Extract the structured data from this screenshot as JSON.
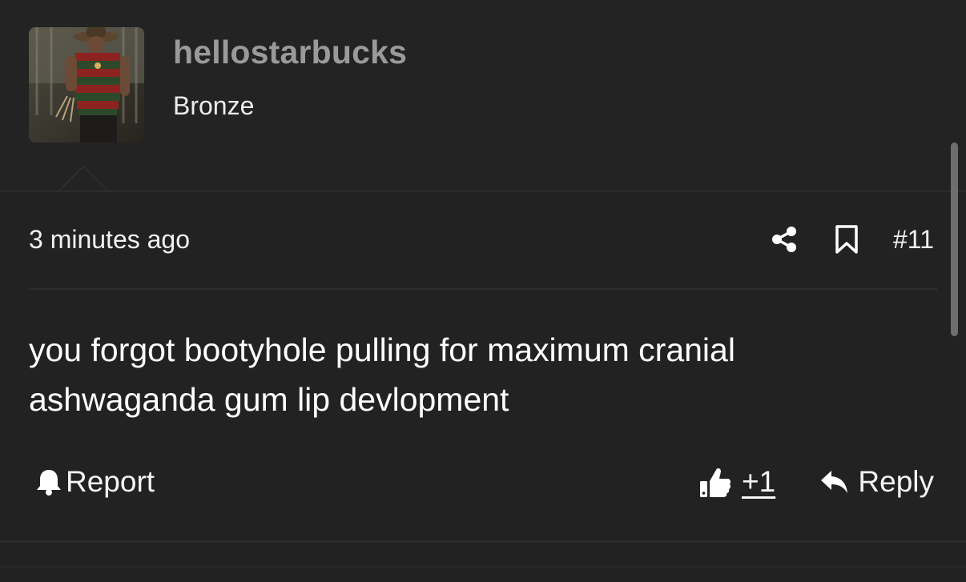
{
  "user": {
    "username": "hellostarbucks",
    "title": "Bronze"
  },
  "post": {
    "timestamp": "3 minutes ago",
    "number": "#11",
    "body": "you forgot bootyhole pulling for maximum cranial ashwaganda gum lip devlopment"
  },
  "actions": {
    "report_label": "Report",
    "like_count": "+1",
    "reply_label": "Reply"
  },
  "icons": {
    "share": "share-icon",
    "bookmark": "bookmark-icon",
    "bell": "bell-icon",
    "thumbs_up": "thumbs-up-icon",
    "reply": "reply-arrow-icon"
  },
  "colors": {
    "background": "#222222",
    "username": "#9a9a9a",
    "text": "#ffffff",
    "divider": "#2f2f2f"
  }
}
